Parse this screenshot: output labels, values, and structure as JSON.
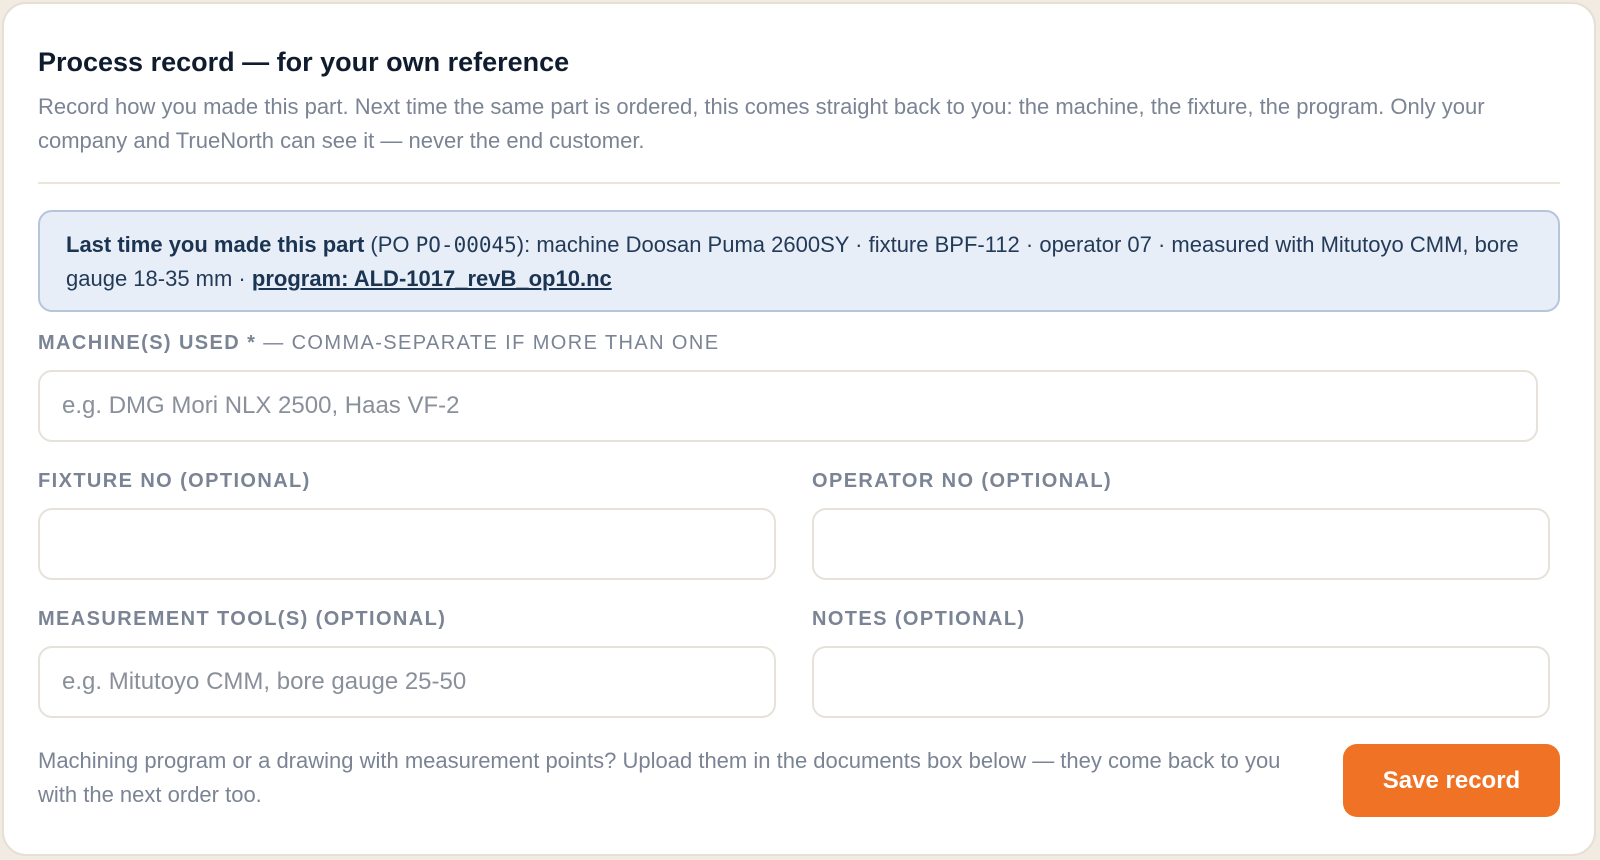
{
  "header": {
    "title": "Process record — for your own reference",
    "subtitle": "Record how you made this part. Next time the same part is ordered, this comes straight back to you: the machine, the fixture, the program. Only your company and TrueNorth can see it — never the end customer."
  },
  "last_time": {
    "lead": "Last time you made this part",
    "po_prefix": " (PO ",
    "po_number": "PO-00045",
    "details": "): machine Doosan Puma 2600SY · fixture BPF-112 · operator 07 · measured with Mitutoyo CMM, bore gauge 18-35 mm · ",
    "program_link": "program: ALD-1017_revB_op10.nc"
  },
  "form": {
    "machines": {
      "label": "Machine(s) used *",
      "hint": " — comma-separate if more than one",
      "placeholder": "e.g. DMG Mori NLX 2500, Haas VF-2",
      "value": ""
    },
    "fixture": {
      "label": "Fixture no (optional)",
      "placeholder": "",
      "value": ""
    },
    "operator": {
      "label": "Operator no (optional)",
      "placeholder": "",
      "value": ""
    },
    "measurement": {
      "label": "Measurement tool(s) (optional)",
      "placeholder": "e.g. Mitutoyo CMM, bore gauge 25-50",
      "value": ""
    },
    "notes": {
      "label": "Notes (optional)",
      "placeholder": "",
      "value": ""
    }
  },
  "footer": {
    "note": "Machining program or a drawing with measurement points? Upload them in the documents box below — they come back to you with the next order too.",
    "save_label": "Save record"
  },
  "colors": {
    "accent": "#f07225",
    "info_bg": "#e7eef7",
    "info_border": "#b4c5dd",
    "muted_text": "#7b8494"
  }
}
